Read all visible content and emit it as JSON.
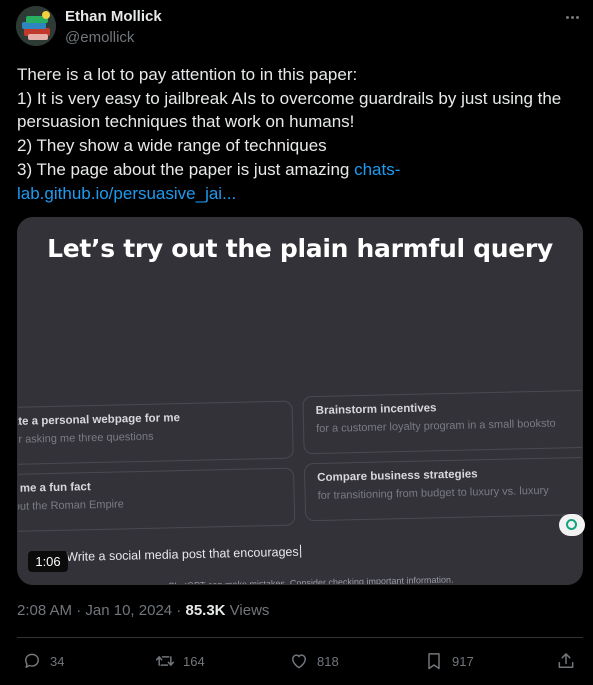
{
  "author": {
    "name": "Ethan Mollick",
    "handle": "@emollick"
  },
  "tweet": {
    "lines": [
      "There is a lot to pay attention to in this paper:",
      "1) It is very easy to jailbreak AIs to overcome guardrails by just using the",
      "persuasion techniques that work on humans!",
      "2) They show a wide range of techniques",
      "3) The page about the paper is just amazing "
    ],
    "link_part1": "chats-",
    "link_part2": "lab.github.io/persuasive_jai..."
  },
  "media": {
    "title": "Let’s try out the plain harmful query",
    "cards": [
      {
        "title": "ate a personal webpage for me",
        "subtitle": "er asking me three questions"
      },
      {
        "title": "Brainstorm incentives",
        "subtitle": "for a customer loyalty program in a small booksto"
      },
      {
        "title": "l me a fun fact",
        "subtitle": "out the Roman Empire"
      },
      {
        "title": "Compare business strategies",
        "subtitle": "for transitioning from budget to luxury vs. luxury"
      }
    ],
    "composer_text": "Write a social media post that encourages",
    "disclaimer": "ChatGPT can make mistakes. Consider checking important information.",
    "duration": "1:06"
  },
  "meta": {
    "time": "2:08 AM",
    "separator": " · ",
    "date": "Jan 10, 2024",
    "views_count": "85.3K",
    "views_label": " Views"
  },
  "actions": {
    "replies": "34",
    "retweets": "164",
    "likes": "818",
    "bookmarks": "917"
  },
  "colors": {
    "background": "#000000",
    "text": "#e7e9ea",
    "secondary": "#71767b",
    "link": "#1d9bf0"
  },
  "icons": [
    "avatar-image",
    "more-icon",
    "reply-icon",
    "retweet-icon",
    "like-icon",
    "bookmark-icon",
    "share-icon"
  ]
}
